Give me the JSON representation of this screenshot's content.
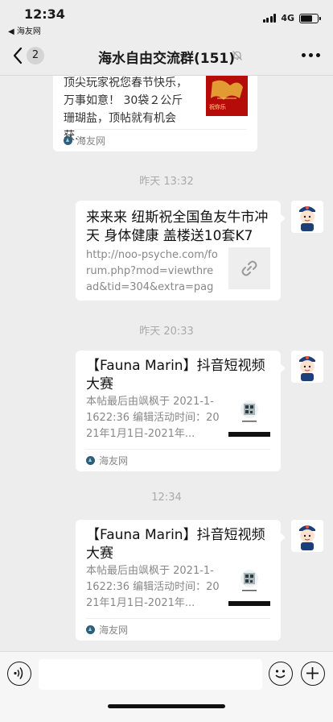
{
  "status": {
    "time": "12:34",
    "back_app": "◀ 海友网",
    "network": "4G",
    "battery_percent": 70
  },
  "nav": {
    "unread_count": "2",
    "title": "海水自由交流群(151)"
  },
  "messages": {
    "m1": {
      "title": "顶尖玩家祝您春节快乐，万事如意！ 30袋２公斤珊瑚盐，顶帖就有机会获...",
      "source": "海友网",
      "thumb_text": "祝你乐"
    },
    "t1": "昨天 13:32",
    "m2": {
      "title": "来来来 纽斯祝全国鱼友牛市冲天 身体健康 盖楼送10套K7 ...",
      "desc": "http://noo-psyche.com/forum.php?mod=viewthread&tid=304&extra=page..."
    },
    "t2": "昨天 20:33",
    "m3": {
      "title": "【Fauna Marin】抖音短视频大赛",
      "desc": "本帖最后由飒枫于 2021-1-1622:36 编辑活动时间：2021年1月1日-2021年...",
      "source": "海友网"
    },
    "t3": "12:34",
    "m4": {
      "title": "【Fauna Marin】抖音短视频大赛",
      "desc": "本帖最后由飒枫于 2021-1-1622:36 编辑活动时间：2021年1月1日-2021年...",
      "source": "海友网"
    }
  },
  "icons": {
    "back": "chevron-left-icon",
    "mute": "bell-slash-icon",
    "more": "more-dots-icon",
    "voice": "voice-icon",
    "emoji": "emoji-icon",
    "plus": "plus-icon"
  }
}
